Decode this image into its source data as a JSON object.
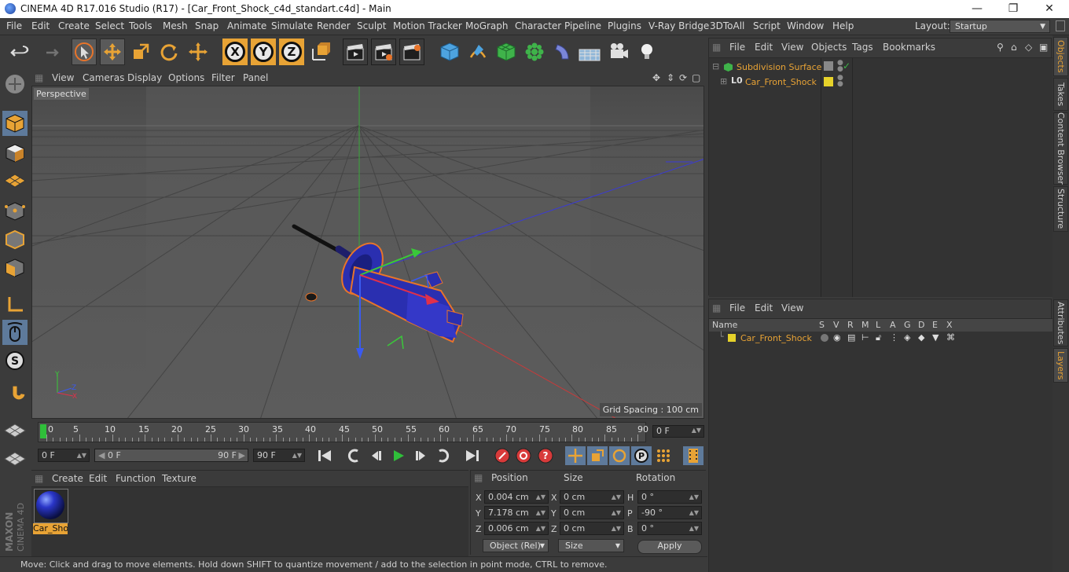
{
  "window": {
    "title": "CINEMA 4D R17.016 Studio (R17) - [Car_Front_Shock_c4d_standart.c4d] - Main",
    "controls": [
      "—",
      "❐",
      "✕"
    ]
  },
  "menubar": {
    "items": [
      "File",
      "Edit",
      "Create",
      "Select",
      "Tools",
      "Mesh",
      "Snap",
      "Animate",
      "Simulate",
      "Render",
      "Sculpt",
      "Motion Tracker",
      "MoGraph",
      "Character",
      "Pipeline",
      "Plugins",
      "V-Ray Bridge",
      "3DToAll",
      "Script",
      "Window",
      "Help"
    ],
    "layout_label": "Layout:",
    "layout_value": "Startup"
  },
  "toolbar": {
    "axis_x": "X",
    "axis_y": "Y",
    "axis_z": "Z"
  },
  "viewport": {
    "menu": [
      "View",
      "Cameras",
      "Display",
      "Options",
      "Filter",
      "Panel"
    ],
    "label": "Perspective",
    "grid_spacing": "Grid Spacing : 100 cm"
  },
  "timeline": {
    "ticks": [
      "0",
      "5",
      "10",
      "15",
      "20",
      "25",
      "30",
      "35",
      "40",
      "45",
      "50",
      "55",
      "60",
      "65",
      "70",
      "75",
      "80",
      "85",
      "90"
    ],
    "current_frame": "0 F",
    "start_frame": "0 F",
    "range_start": "0 F",
    "range_end": "90 F",
    "end_frame": "90 F"
  },
  "materials": {
    "menu": [
      "Create",
      "Edit",
      "Function",
      "Texture"
    ],
    "items": [
      {
        "name": "Car_Sho"
      }
    ]
  },
  "coordinates": {
    "headers": {
      "position": "Position",
      "size": "Size",
      "rotation": "Rotation"
    },
    "rows": [
      {
        "axis": "X",
        "position": "0.004 cm",
        "size_axis": "X",
        "size": "0 cm",
        "rot_axis": "H",
        "rotation": "0 °"
      },
      {
        "axis": "Y",
        "position": "7.178 cm",
        "size_axis": "Y",
        "size": "0 cm",
        "rot_axis": "P",
        "rotation": "-90 °"
      },
      {
        "axis": "Z",
        "position": "0.006 cm",
        "size_axis": "Z",
        "size": "0 cm",
        "rot_axis": "B",
        "rotation": "0 °"
      }
    ],
    "mode": "Object (Rel)",
    "size_mode": "Size",
    "apply": "Apply"
  },
  "status": "Move: Click and drag to move elements. Hold down SHIFT to quantize movement / add to the selection in point mode, CTRL to remove.",
  "objects_panel": {
    "menu": [
      "File",
      "Edit",
      "View",
      "Objects",
      "Tags",
      "Bookmarks"
    ],
    "tree": [
      {
        "name": "Subdivision Surface"
      },
      {
        "name": "Car_Front_Shock"
      }
    ]
  },
  "layers_panel": {
    "menu": [
      "File",
      "Edit",
      "View"
    ],
    "columns": [
      "Name",
      "S",
      "V",
      "R",
      "M",
      "L",
      "A",
      "G",
      "D",
      "E",
      "X"
    ],
    "rows": [
      {
        "name": "Car_Front_Shock",
        "color": "#e6d22a"
      }
    ]
  },
  "right_tabs": [
    "Objects",
    "Takes",
    "Content Browser",
    "Structure",
    "Attributes",
    "Layers"
  ],
  "branding": {
    "logo_text": "MAXON CINEMA 4D"
  },
  "colors": {
    "accent": "#e8a335",
    "selection_blue": "#5e7a9b",
    "model_blue": "#2a2fb0"
  }
}
